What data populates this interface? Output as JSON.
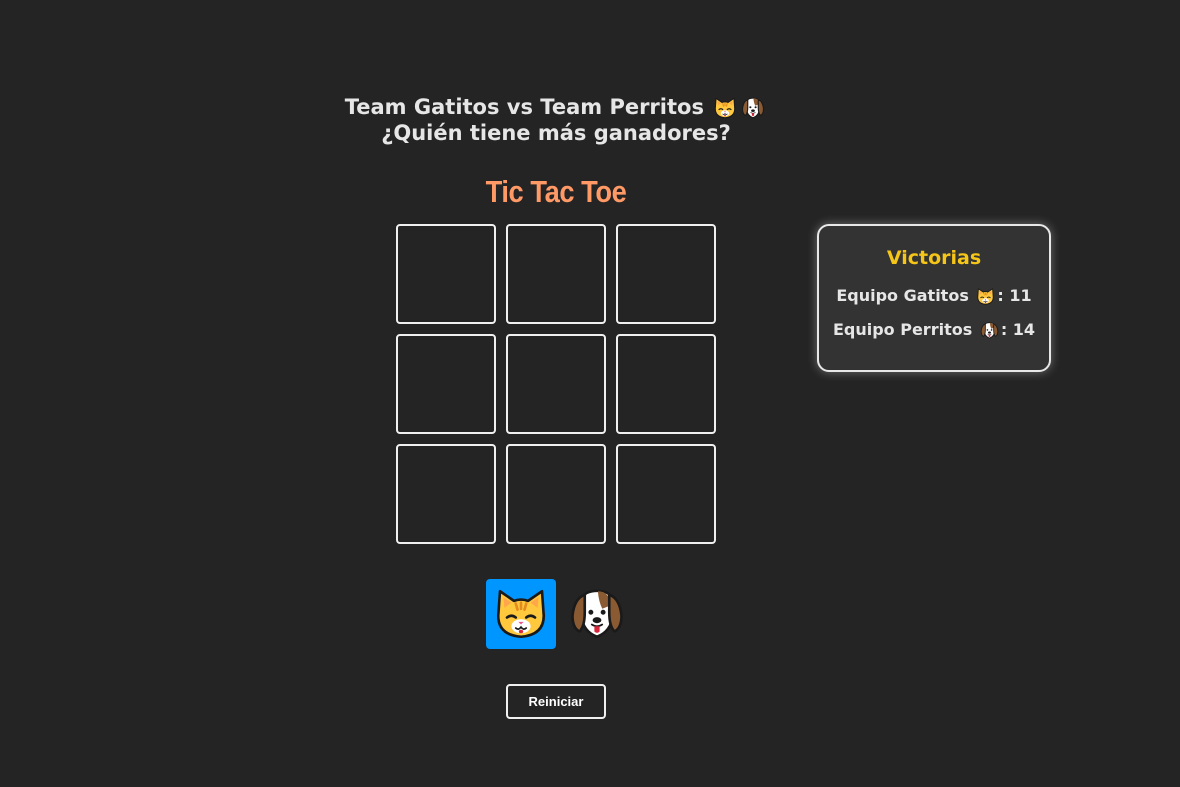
{
  "header": {
    "line1": "Team Gatitos vs Team Perritos",
    "line2": "¿Quién tiene más ganadores?",
    "icons": [
      "cat-face-icon",
      "dog-face-icon"
    ]
  },
  "game": {
    "title": "Tic Tac Toe",
    "cells": [
      "",
      "",
      "",
      "",
      "",
      "",
      "",
      "",
      ""
    ]
  },
  "scoreboard": {
    "title": "Victorias",
    "cats_label": "Equipo Gatitos",
    "cats_score": ": 11",
    "dogs_label": "Equipo Perritos",
    "dogs_score": ": 14"
  },
  "players": [
    {
      "icon": "cat-face-icon",
      "selected": true
    },
    {
      "icon": "dog-face-icon",
      "selected": false
    }
  ],
  "controls": {
    "reset_label": "Reiniciar"
  },
  "colors": {
    "background": "#242424",
    "title_accent": "#ff9966",
    "wins_title": "#f5c518",
    "selected_player": "#0096ff"
  }
}
